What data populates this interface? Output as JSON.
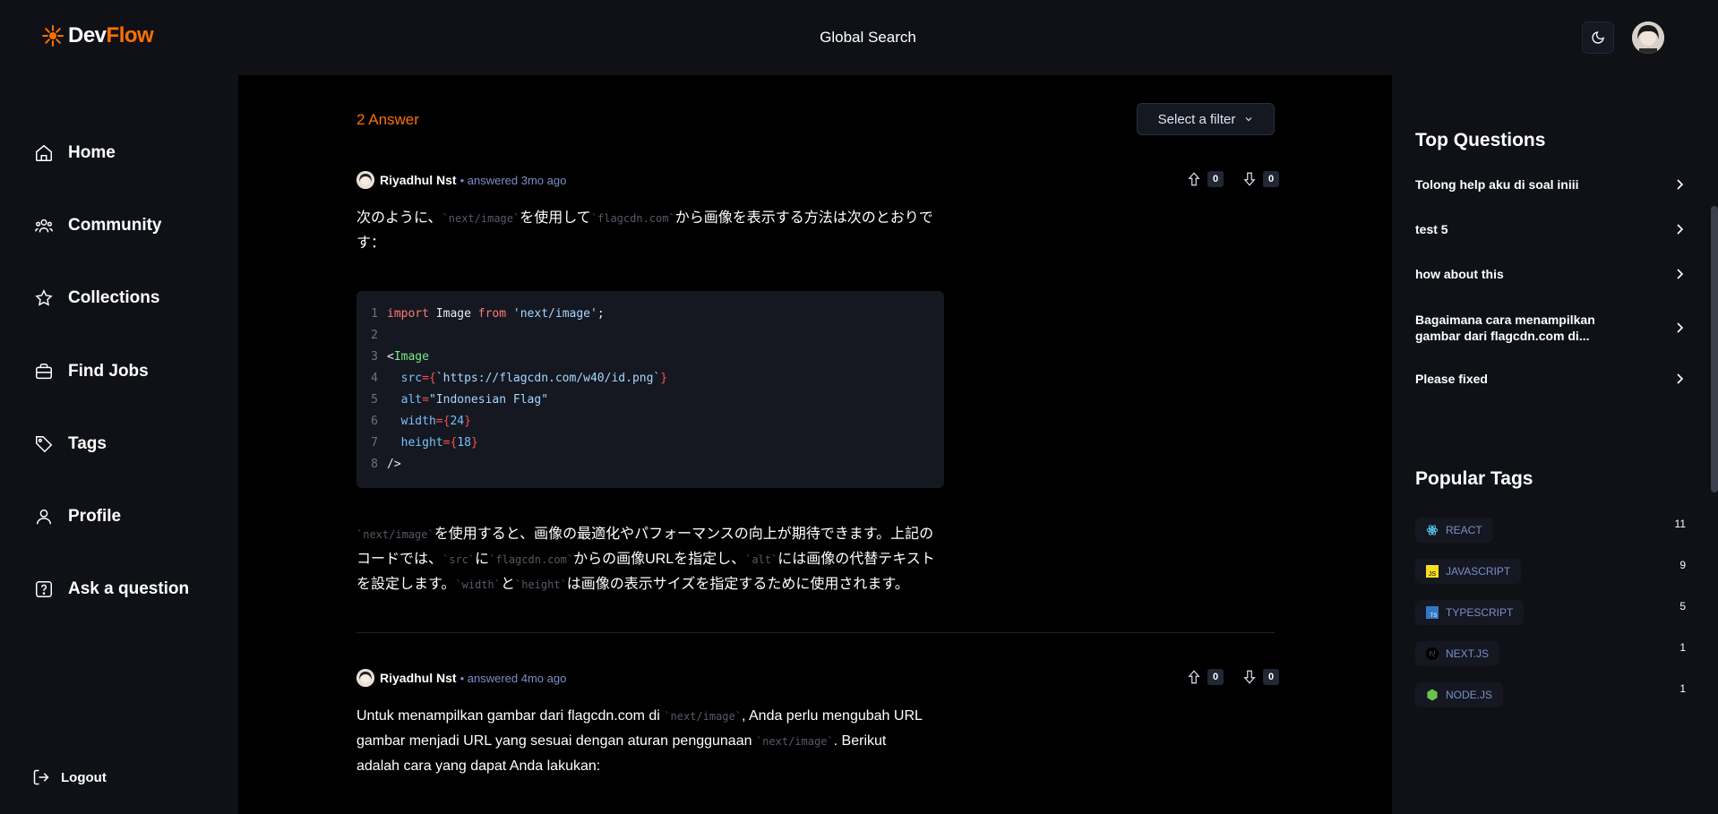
{
  "brand": {
    "part1": "Dev",
    "part2": "Flow"
  },
  "header": {
    "search_label": "Global Search"
  },
  "sidebar": {
    "items": [
      {
        "label": "Home",
        "icon": "home-icon"
      },
      {
        "label": "Community",
        "icon": "community-icon"
      },
      {
        "label": "Collections",
        "icon": "star-icon"
      },
      {
        "label": "Find Jobs",
        "icon": "briefcase-icon"
      },
      {
        "label": "Tags",
        "icon": "tag-icon"
      },
      {
        "label": "Profile",
        "icon": "user-icon"
      },
      {
        "label": "Ask a question",
        "icon": "question-icon"
      }
    ],
    "logout": "Logout"
  },
  "main": {
    "answers_count": "2 Answer",
    "filter_placeholder": "Select a filter",
    "answers": [
      {
        "author": "Riyadhul Nst",
        "time": "• answered 3mo ago",
        "upvotes": "0",
        "downvotes": "0",
        "intro_parts": [
          "次のように、",
          "`next/image`",
          "を使用して",
          "`flagcdn.com`",
          "から画像を表示する方法は次のとおりです："
        ],
        "code_lines": [
          "import Image from 'next/image';",
          "",
          "<Image",
          "  src={`https://flagcdn.com/w40/id.png`}",
          "  alt=\"Indonesian Flag\"",
          "  width={24}",
          "  height={18}",
          "/>"
        ],
        "outro_parts": [
          "`next/image`",
          "を使用すると、画像の最適化やパフォーマンスの向上が期待できます。上記のコードでは、",
          "`src`",
          "に",
          "`flagcdn.com`",
          "からの画像URLを指定し、",
          "`alt`",
          "には画像の代替テキストを設定します。",
          "`width`",
          "と",
          "`height`",
          "は画像の表示サイズを指定するために使用されます。"
        ]
      },
      {
        "author": "Riyadhul Nst",
        "time": "• answered 4mo ago",
        "upvotes": "0",
        "downvotes": "0",
        "text_parts": [
          "Untuk menampilkan gambar dari flagcdn.com di ",
          "`next/image`",
          ", Anda perlu mengubah URL gambar menjadi URL yang sesuai dengan aturan penggunaan ",
          "`next/image`",
          ". Berikut adalah cara yang dapat Anda lakukan:"
        ]
      }
    ]
  },
  "right_sidebar": {
    "top_questions_title": "Top Questions",
    "top_questions": [
      "Tolong help aku di soal iniii",
      "test 5",
      "how about this",
      "Bagaimana cara menampilkan gambar dari flagcdn.com di...",
      "Please fixed"
    ],
    "popular_tags_title": "Popular Tags",
    "tags": [
      {
        "name": "REACT",
        "count": "11",
        "icon": "react-icon",
        "color": "#61dafb"
      },
      {
        "name": "JAVASCRIPT",
        "count": "9",
        "icon": "javascript-icon",
        "color": "#f7df1e"
      },
      {
        "name": "TYPESCRIPT",
        "count": "5",
        "icon": "typescript-icon",
        "color": "#3178c6"
      },
      {
        "name": "NEXT.JS",
        "count": "1",
        "icon": "nextjs-icon",
        "color": "#000000"
      },
      {
        "name": "NODE.JS",
        "count": "1",
        "icon": "nodejs-icon",
        "color": "#6cc24a"
      }
    ]
  },
  "colors": {
    "accent": "#ff7000",
    "background": "#0f1117",
    "panel": "#151821",
    "link_blue": "#7b8ec8"
  }
}
